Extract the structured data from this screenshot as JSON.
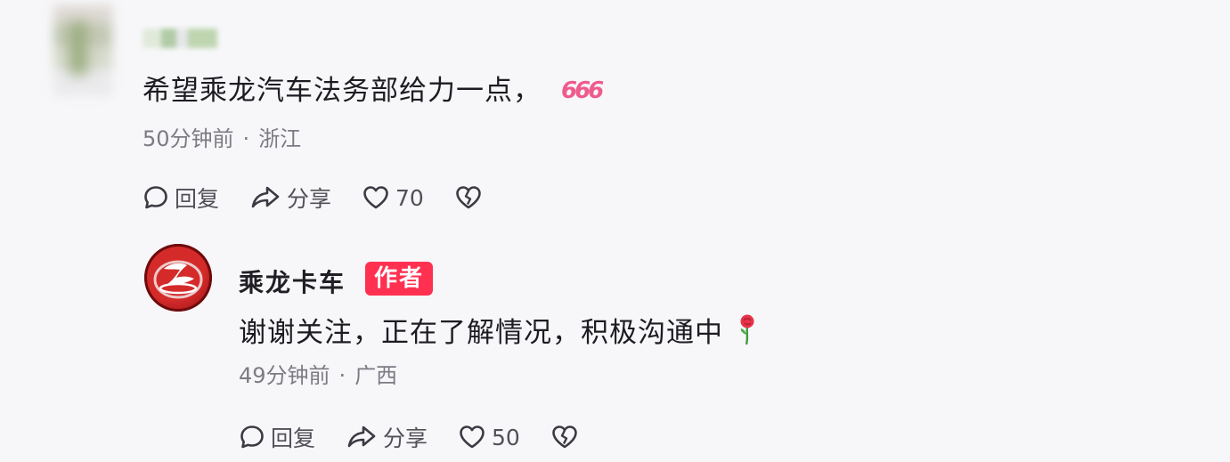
{
  "comments": [
    {
      "text": "希望乘龙汽车法务部给力一点，",
      "emoji": "666",
      "time": "50分钟前",
      "separator": "·",
      "location": "浙江",
      "actions": {
        "reply": "回复",
        "share": "分享",
        "likes": "70"
      }
    },
    {
      "author": "乘龙卡车",
      "badge": "作者",
      "text": "谢谢关注，正在了解情况，积极沟通中",
      "time": "49分钟前",
      "separator": "·",
      "location": "广西",
      "actions": {
        "reply": "回复",
        "share": "分享",
        "likes": "50"
      }
    }
  ],
  "colors": {
    "badge": "#ff3050",
    "emoji": "#ef5b8c",
    "logo": "#d42a2a"
  }
}
